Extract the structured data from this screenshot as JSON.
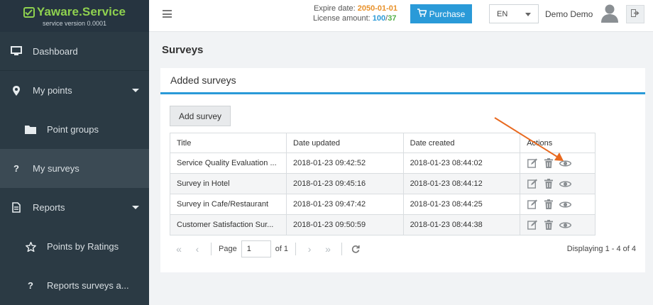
{
  "brand": {
    "name": "Yaware.Service",
    "version": "service version 0.0001"
  },
  "sidebar": {
    "items": [
      {
        "label": "Dashboard",
        "icon": "monitor-icon"
      },
      {
        "label": "My points",
        "icon": "map-marker-icon"
      },
      {
        "label": "Point groups",
        "icon": "folder-icon"
      },
      {
        "label": "My surveys",
        "icon": "question-icon",
        "active": true
      },
      {
        "label": "Reports",
        "icon": "file-icon"
      },
      {
        "label": "Points by Ratings",
        "icon": "star-icon"
      },
      {
        "label": "Reports surveys a...",
        "icon": "question-icon"
      }
    ]
  },
  "topbar": {
    "expire_label": "Expire date:",
    "expire_value": "2050-01-01",
    "license_label": "License amount:",
    "license_used": "100",
    "license_sep": "/",
    "license_total": "37",
    "purchase_label": "Purchase",
    "language": "EN",
    "user_name": "Demo Demo"
  },
  "main": {
    "page_title": "Surveys",
    "panel_title": "Added surveys",
    "add_button": "Add survey",
    "table": {
      "headers": [
        "Title",
        "Date updated",
        "Date created",
        "Actions"
      ],
      "rows": [
        [
          "Service Quality Evaluation ...",
          "2018-01-23 09:42:52",
          "2018-01-23 08:44:02"
        ],
        [
          "Survey in Hotel",
          "2018-01-23 09:45:16",
          "2018-01-23 08:44:12"
        ],
        [
          "Survey in Cafe/Restaurant",
          "2018-01-23 09:47:42",
          "2018-01-23 08:44:25"
        ],
        [
          "Customer Satisfaction Sur...",
          "2018-01-23 09:50:59",
          "2018-01-23 08:44:38"
        ]
      ]
    },
    "pager": {
      "page_label": "Page",
      "page_value": "1",
      "of_label": "of 1",
      "display_text": "Displaying 1 - 4 of 4"
    }
  },
  "colors": {
    "accent": "#2a9ad8",
    "brand_green": "#8fd14f",
    "sidebar_bg": "#2b3a44",
    "expire_orange": "#e8912a",
    "license_green": "#55b04a",
    "annotation_arrow": "#e8691f"
  }
}
